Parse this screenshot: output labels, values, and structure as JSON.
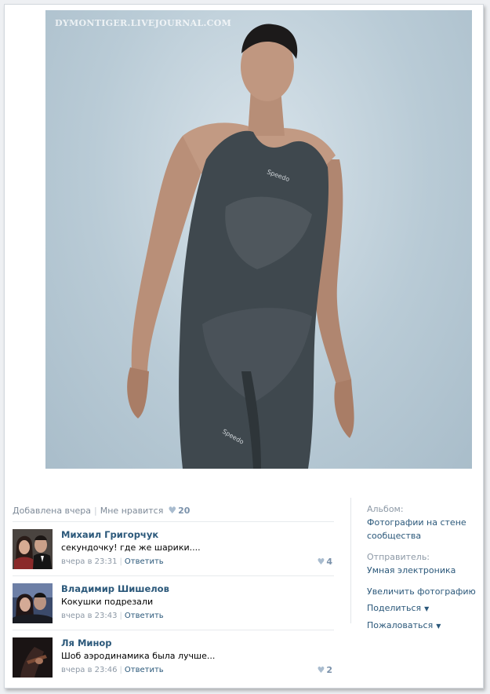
{
  "photo": {
    "watermark": "DYMONTIGER.LIVEJOURNAL.COM",
    "subject": "swimmer-in-speedo-suit"
  },
  "meta": {
    "added": "Добавлена вчера",
    "like_label": "Мне нравится",
    "likes": "20"
  },
  "comments": [
    {
      "name": "Михаил Григорчук",
      "text": "секундочку! где же шарики....",
      "time": "вчера в 23:31",
      "reply": "Ответить",
      "likes": "4"
    },
    {
      "name": "Владимир Шишелов",
      "text": "Кокушки подрезали",
      "time": "вчера в 23:43",
      "reply": "Ответить",
      "likes": ""
    },
    {
      "name": "Ля Минор",
      "text": "Шоб аэродинамика была лучше...",
      "time": "вчера в 23:46",
      "reply": "Ответить",
      "likes": "2"
    }
  ],
  "sidebar": {
    "album_label": "Альбом:",
    "album_value": "Фотографии на стене сообщества",
    "sender_label": "Отправитель:",
    "sender_value": "Умная электроника",
    "enlarge": "Увеличить фотографию",
    "share": "Поделиться",
    "report": "Пожаловаться"
  },
  "colors": {
    "link": "#2b587a",
    "muted": "#8d99a6",
    "heart": "#a9bccf"
  }
}
